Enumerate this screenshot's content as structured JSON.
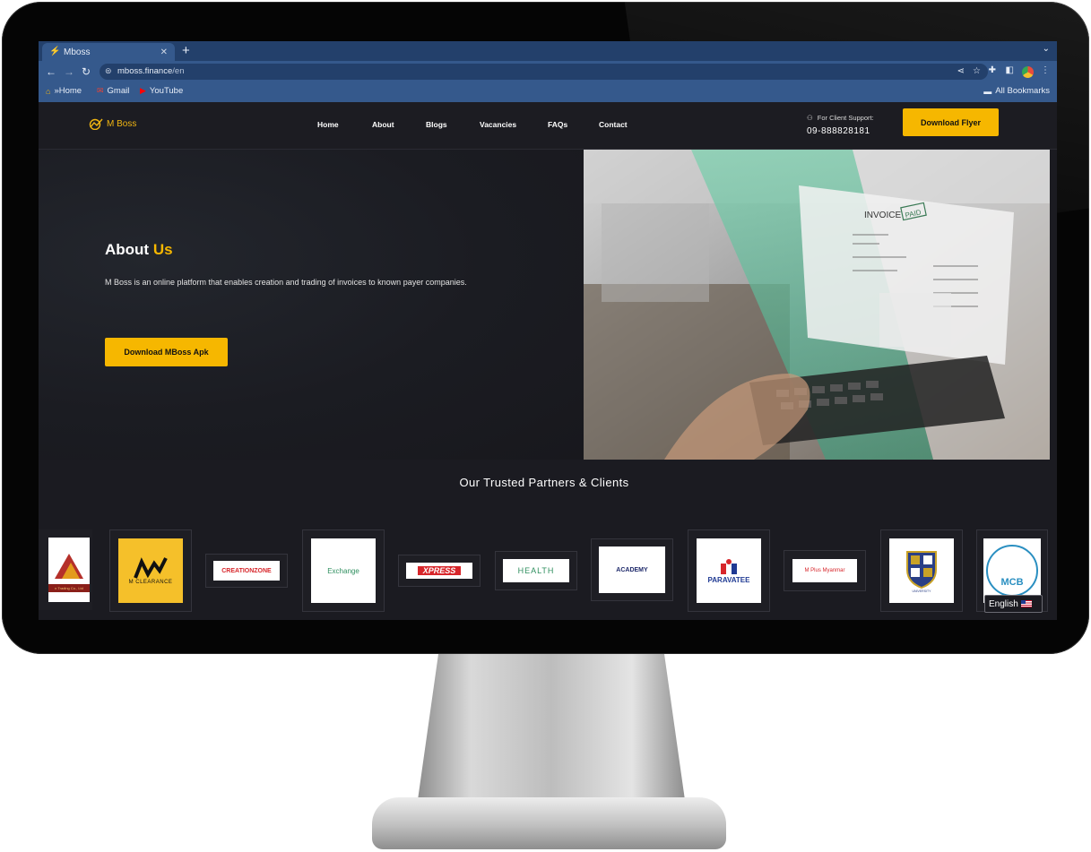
{
  "browser": {
    "tab_title": "Mboss",
    "new_tab": "+",
    "url_host": "mboss.finance",
    "url_path": "/en",
    "bookmarks": [
      {
        "label": "»Home",
        "icon": "home-bookmark-icon"
      },
      {
        "label": "Gmail",
        "icon": "gmail-icon"
      },
      {
        "label": "YouTube",
        "icon": "youtube-icon"
      }
    ],
    "all_bookmarks": "All Bookmarks"
  },
  "site": {
    "logo_text": "M Boss",
    "nav": [
      "Home",
      "About",
      "Blogs",
      "Vacancies",
      "FAQs",
      "Contact"
    ],
    "support_label": "For Client Support:",
    "support_phone": "09-888828181",
    "flyer_button": "Download Flyer"
  },
  "hero": {
    "title_main": "About ",
    "title_accent": "Us",
    "description": "M Boss is an online platform that enables creation and trading of invoices to known payer companies.",
    "apk_button": "Download MBoss Apk",
    "image_text": [
      "INVOICE",
      "PAID"
    ]
  },
  "partners": {
    "title": "Our Trusted Partners & Clients",
    "logos": [
      {
        "name": "Trading Co., Ltd",
        "text": "n Trading Co., Ltd"
      },
      {
        "name": "M Clearance",
        "text": "M CLEARANCE"
      },
      {
        "name": "Creation Zone",
        "text": "CREATIONZONE"
      },
      {
        "name": "M Exchange",
        "text": "Exchange"
      },
      {
        "name": "M Xpress",
        "text": "XPRESS"
      },
      {
        "name": "M Health",
        "text": "HEALTH"
      },
      {
        "name": "M Academy",
        "text": "ACADEMY"
      },
      {
        "name": "Paravatee",
        "text": "PARAVATEE"
      },
      {
        "name": "M Plus Myanmar",
        "text": "M Plus Myanmar"
      },
      {
        "name": "University crest",
        "text": "UNIVERSITY"
      },
      {
        "name": "MCB",
        "text": "MCB"
      }
    ]
  },
  "language": {
    "label": "English"
  },
  "colors": {
    "accent": "#f6b700",
    "page_bg": "#1b1b21",
    "browser_frame": "#35598c"
  }
}
